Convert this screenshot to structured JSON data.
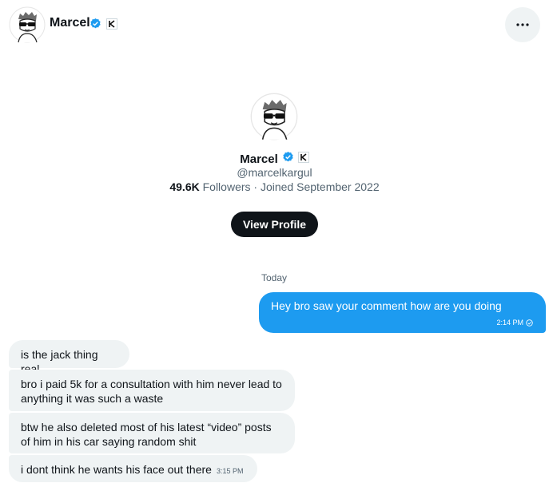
{
  "header": {
    "name": "Marcel",
    "verified_icon": "verified-badge-icon",
    "affiliate_icon": "affiliate-badge-icon",
    "more_icon": "more-horizontal-icon"
  },
  "profile": {
    "name": "Marcel",
    "handle": "@marcelkargul",
    "followers_count": "49.6K",
    "followers_label": "Followers",
    "joined": "· Joined September 2022",
    "view_profile_label": "View Profile"
  },
  "conversation": {
    "day_label": "Today",
    "outgoing": {
      "text": "Hey bro saw your comment how are you doing",
      "time": "2:14 PM",
      "status_icon": "sent-check-icon"
    },
    "incoming": [
      {
        "text": "is the jack thing real"
      },
      {
        "text": "bro i paid 5k for a consultation with him never lead to anything it was such a waste"
      },
      {
        "text": "btw he also deleted most of his latest “video” posts of him in his car saying random shit"
      },
      {
        "text": "i dont think he wants his face out there",
        "time": "3:15 PM"
      }
    ]
  },
  "colors": {
    "accent": "#1d9bf0",
    "text": "#0f1419",
    "muted": "#536471",
    "bubble_in": "#eff3f4"
  }
}
